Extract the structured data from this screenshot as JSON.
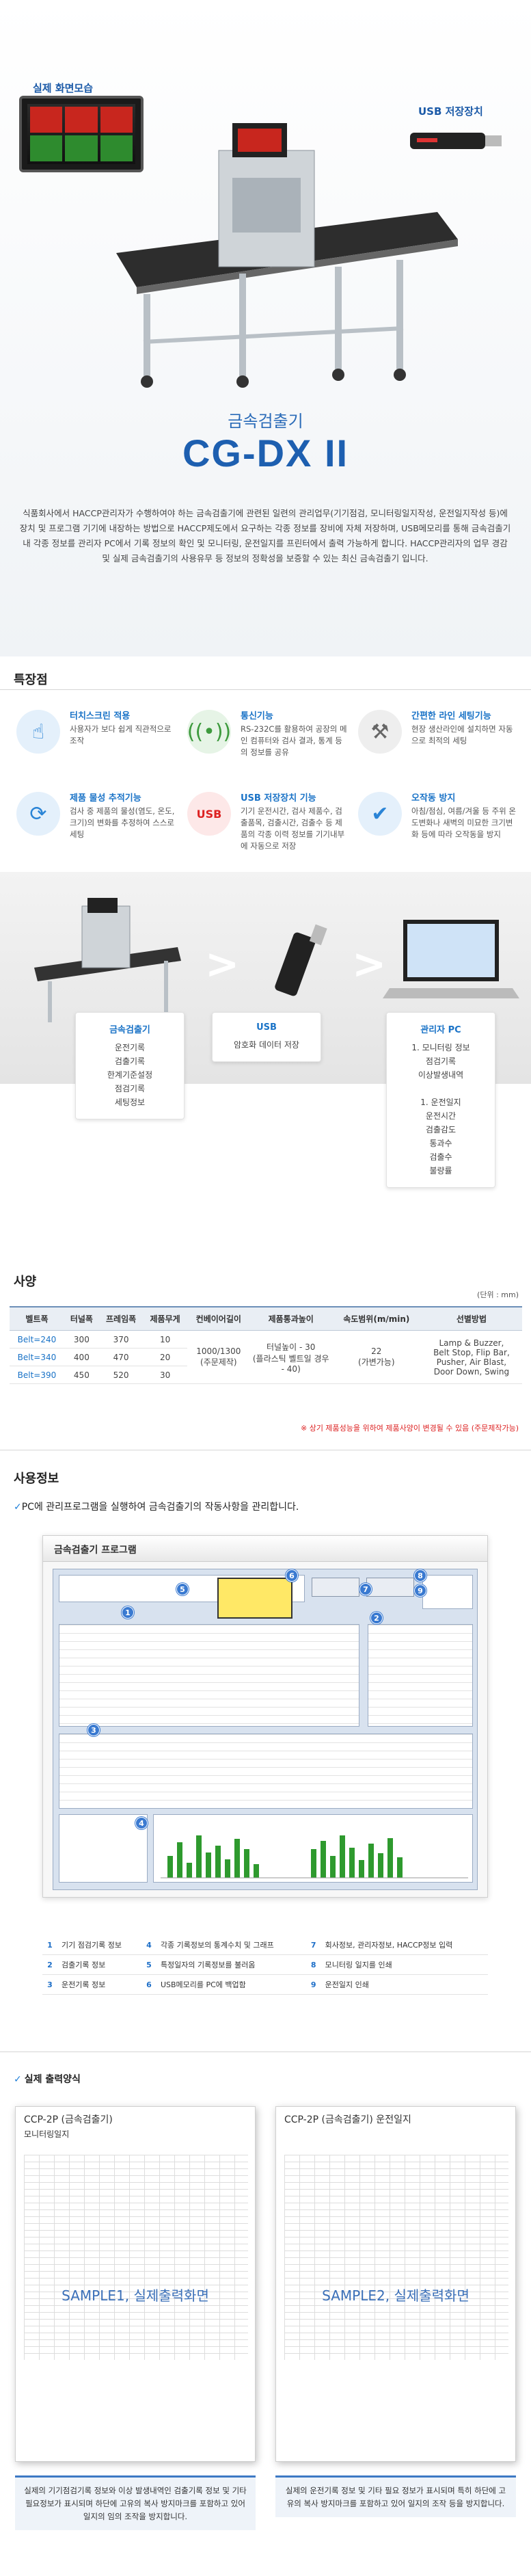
{
  "hero": {
    "screen_label": "실제 화면모습",
    "usb_label": "USB 저장장치",
    "subtitle": "금속검출기",
    "model": "CG-DX II",
    "description": "식품회사에서 HACCP관리자가 수행하여야 하는 금속검출기에 관련된 일련의 관리업무(기기점검, 모니터링일지작성, 운전일지작성 등)에 장치 및 프로그램 기기에 내장하는 방법으로 HACCP제도에서 요구하는 각종 정보를 장비에 자체 저장하며, USB메모리를 통해 금속검출기 내 각종 정보를 관리자 PC에서 기록 정보의 확인 및 모니터링, 운전일지를 프린터에서 출력 가능하게 합니다. HACCP관리자의 업무 경감 및 실제 금속검출기의 사용유무 등 정보의 정확성을 보증할 수 있는 최신 금속검출기 입니다."
  },
  "features": {
    "heading": "특장점",
    "items": [
      {
        "icon": "touch-icon",
        "title": "터치스크린 적용",
        "desc": "사용자가 보다 쉽게 직관적으로 조작"
      },
      {
        "icon": "signal-icon",
        "title": "통신기능",
        "desc": "RS-232C를 활용하여 공장의 메인 컴퓨터와 검사 결과, 통계 등의 정보를 공유"
      },
      {
        "icon": "tools-icon",
        "title": "간편한 라인 세팅기능",
        "desc": "현장 생산라인에 설치하면 자동으로 최적의 세팅"
      },
      {
        "icon": "refresh-icon",
        "title": "제품 물성 추적기능",
        "desc": "검사 중 제품의 물성(염도, 온도, 크기)의 변화를 추정하여 스스로 세팅"
      },
      {
        "icon": "usb-icon",
        "title": "USB 저장장치 기능",
        "desc": "기기 운전시간, 검사 제품수, 검출품목, 검출시간, 검출수 등 제품의 각종 이력 정보를 기기내부에 자동으로 저장"
      },
      {
        "icon": "check-icon",
        "title": "오작동 방지",
        "desc": "아침/점심, 여름/겨울 등 주위 온도변화나 새벽의 미묘한 크기변화 등에 따라 오작동을 방지"
      }
    ]
  },
  "flow_cards": [
    {
      "title": "금속검출기",
      "lines": "운전기록\n검출기록\n한계기준설정\n점검기록\n세팅정보"
    },
    {
      "title": "USB",
      "lines": "암호화 데이터 저장"
    },
    {
      "title": "관리자 PC",
      "lines": "1. 모니터링 정보\n점검기록\n이상발생내역\n\n1. 운전일지\n운전시간\n검출감도\n통과수\n검출수\n불량률"
    }
  ],
  "spec": {
    "heading": "사양",
    "unit": "(단위 : mm)",
    "columns": [
      "벨트폭",
      "터널폭",
      "프레임폭",
      "제품무게",
      "컨베이어길이",
      "제품통과높이",
      "속도범위(m/min)",
      "선별방법"
    ],
    "rows": [
      [
        "Belt=240",
        "300",
        "370",
        "10",
        "",
        "",
        "",
        ""
      ],
      [
        "Belt=340",
        "400",
        "470",
        "20",
        "",
        "",
        "",
        ""
      ],
      [
        "Belt=390",
        "450",
        "520",
        "30",
        "",
        "",
        "",
        ""
      ]
    ],
    "merged": {
      "conveyor": "1000/1300\n(주문제작)",
      "height": "터널높이 - 30\n(플라스틱 벨트일 경우 - 40)",
      "speed": "22\n(가변가능)",
      "method": "Lamp & Buzzer,\nBelt Stop, Flip Bar,\nPusher, Air Blast,\nDoor Down, Swing"
    },
    "note": "※ 상기 제품성능을 위하여 제품사양이 변경될 수 있음 (주문제작가능)"
  },
  "software": {
    "heading": "사용정보",
    "lead": "PC에 관리프로그램을 실행하여 금속검출기의 작동사항을 관리합니다.",
    "window_title": "금속검출기 프로그램",
    "legend": [
      [
        "1",
        "기기 점검기록 정보",
        "4",
        "각종 기록정보의 통계수치 및 그래프",
        "7",
        "회사정보, 관리자정보, HACCP정보 입력"
      ],
      [
        "2",
        "검출기록 정보",
        "5",
        "특정일자의 기록정보를 불러옴",
        "8",
        "모니터링 일지를 인쇄"
      ],
      [
        "3",
        "운전기록 정보",
        "6",
        "USB메모리를 PC에 백업함",
        "9",
        "운전일지 인쇄"
      ]
    ]
  },
  "output": {
    "heading": "실제 출력양식",
    "sheets": [
      {
        "title": "CCP-2P (금속검출기)",
        "sub": "모니터링일지",
        "sample": "SAMPLE1, 실제출력화면",
        "caption": "실제의 기기점검기록 정보와 이상 발생내역인 검출기록 정보 및 기타 필요정보가 표시되며 하단에 고유의 복사 방지마크를 포함하고 있어 일지의 임의 조작을 방지합니다."
      },
      {
        "title": "CCP-2P (금속검출기) 운전일지",
        "sub": "",
        "sample": "SAMPLE2, 실제출력화면",
        "caption": "실제의 운전기록 정보 및 기타 필요 정보가 표시되며 특히 하단에 고유의 복사 방지마크를 포함하고 있어 일지의 조작 등을 방지합니다."
      }
    ]
  },
  "colors": {
    "accent": "#1a73c7",
    "title": "#1d5fb0",
    "note": "#dd2222"
  }
}
